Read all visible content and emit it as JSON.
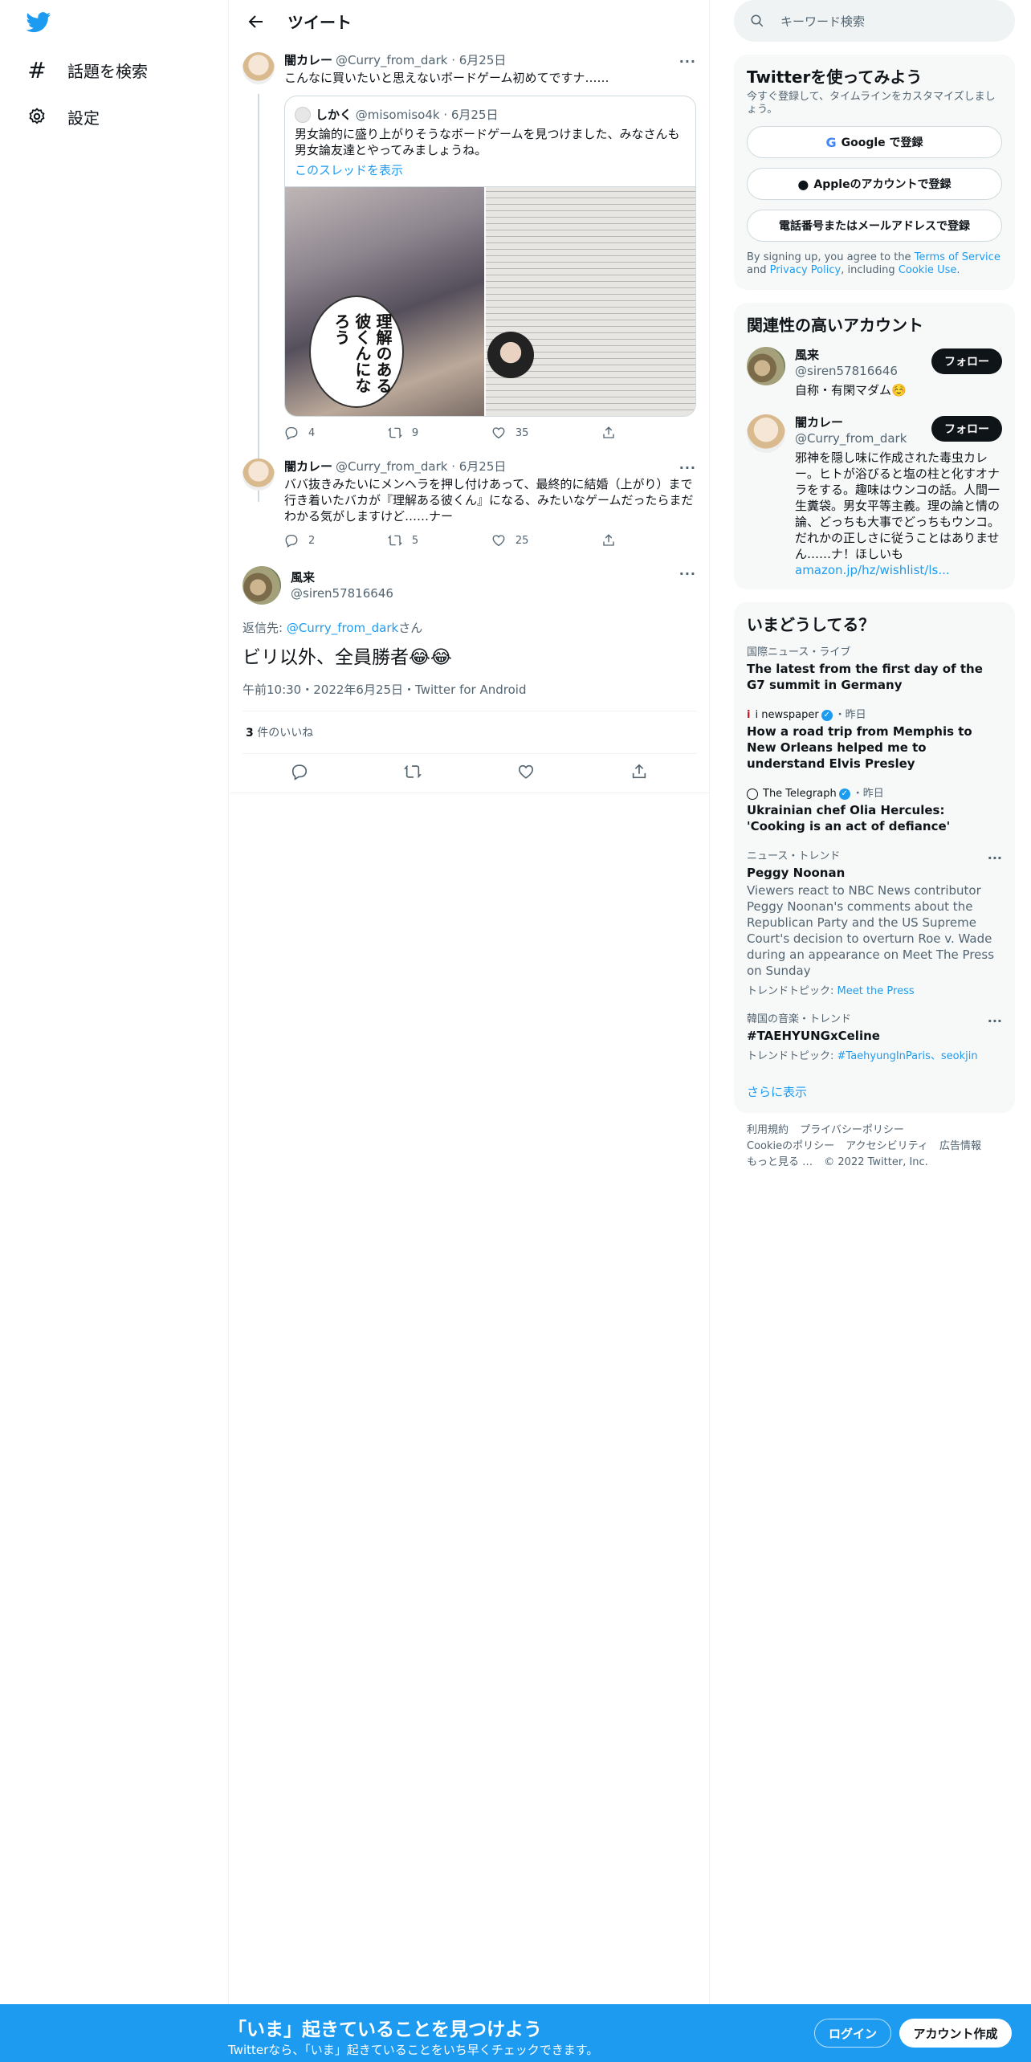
{
  "nav": {
    "items": [
      {
        "icon": "hashtag-icon",
        "label": "話題を検索"
      },
      {
        "icon": "gear-icon",
        "label": "設定"
      }
    ]
  },
  "main": {
    "title": "ツイート",
    "tweets": [
      {
        "name": "闇カレー",
        "handle": "@Curry_from_dark",
        "date": "6月25日",
        "text": "こんなに買いたいと思えないボードゲーム初めてですナ……",
        "quote": {
          "name": "しかく",
          "handle": "@misomiso4k",
          "date": "6月25日",
          "text": "男女論的に盛り上がりそうなボードゲームを見つけました、みなさんも男女論友達とやってみましょうね。",
          "link": "このスレッドを表示",
          "image_caption": "理解のある彼くんになろう"
        },
        "replies": "4",
        "retweets": "9",
        "likes": "35"
      },
      {
        "name": "闇カレー",
        "handle": "@Curry_from_dark",
        "date": "6月25日",
        "text": "ババ抜きみたいにメンヘラを押し付けあって、最終的に結婚（上がり）まで行き着いたバカが『理解ある彼くん』になる、みたいなゲームだったらまだわかる気がしますけど……ナー",
        "replies": "2",
        "retweets": "5",
        "likes": "25"
      }
    ],
    "focus": {
      "name": "風来",
      "handle": "@siren57816646",
      "reply_prefix": "返信先: ",
      "reply_to": "@Curry_from_dark",
      "reply_suffix": "さん",
      "text": "ビリ以外、全員勝者😂😂",
      "time": "午前10:30・2022年6月25日・Twitter for Android",
      "likes_count": "3",
      "likes_label": " 件のいいね"
    }
  },
  "right": {
    "search_placeholder": "キーワード検索",
    "signup": {
      "title": "Twitterを使ってみよう",
      "subtitle": "今すぐ登録して、タイムラインをカスタマイズしましょう。",
      "google": "Google で登録",
      "apple": "Appleのアカウントで登録",
      "email": "電話番号またはメールアドレスで登録",
      "terms_1": "By signing up, you agree to the ",
      "terms_link1": "Terms of Service",
      "terms_2": " and ",
      "terms_link2": "Privacy Policy",
      "terms_3": ", including ",
      "terms_link3": "Cookie Use",
      "terms_4": "."
    },
    "related": {
      "title": "関連性の高いアカウント",
      "accounts": [
        {
          "name": "風来",
          "handle": "@siren57816646",
          "bio": "自称・有閑マダム☺️",
          "follow": "フォロー"
        },
        {
          "name": "闇カレー",
          "handle": "@Curry_from_dark",
          "bio": "邪神を隠し味に作成された毒虫カレー。ヒトが浴びると塩の柱と化すオナラをする。趣味はウンコの話。人間一生糞袋。男女平等主義。理の論と情の論、どっちも大事でどっちもウンコ。だれかの正しさに従うことはありません……ナ！ほしいも",
          "link": "amazon.jp/hz/wishlist/ls...",
          "follow": "フォロー"
        }
      ]
    },
    "trends": {
      "title": "いまどうしてる？",
      "items": [
        {
          "context": "国際ニュース・ライブ",
          "title": "The latest from the first day of the G7 summit in Germany"
        },
        {
          "source": "i newspaper",
          "when": "・昨日",
          "title": "How a road trip from Memphis to New Orleans helped me to understand Elvis Presley"
        },
        {
          "source": "The Telegraph",
          "when": "・昨日",
          "title": "Ukrainian chef Olia Hercules: 'Cooking is an act of defiance'"
        },
        {
          "context": "ニュース・トレンド",
          "title": "Peggy Noonan",
          "desc": "Viewers react to NBC News contributor Peggy Noonan's comments about the Republican Party and the US Supreme Court's decision to overturn Roe v. Wade during an appearance on Meet The Press on Sunday",
          "topic_label": "トレンドトピック: ",
          "topic": "Meet the Press"
        },
        {
          "context": "韓国の音楽・トレンド",
          "title": "#TAEHYUNGxCeline",
          "topic_label": "トレンドトピック: ",
          "topic": "#TaehyungInParis、seokjin"
        }
      ],
      "show_more": "さらに表示"
    },
    "footer": {
      "links": [
        "利用規約",
        "プライバシーポリシー",
        "Cookieのポリシー",
        "アクセシビリティ",
        "広告情報",
        "もっと見る …"
      ],
      "copyright": "© 2022 Twitter, Inc."
    }
  },
  "bottombar": {
    "title": "「いま」起きていることを見つけよう",
    "subtitle": "Twitterなら、「いま」起きていることをいち早くチェックできます。",
    "login": "ログイン",
    "signup": "アカウント作成"
  },
  "colors": {
    "accent": "#1d9bf0",
    "text": "#0f1419",
    "muted": "#536471"
  }
}
